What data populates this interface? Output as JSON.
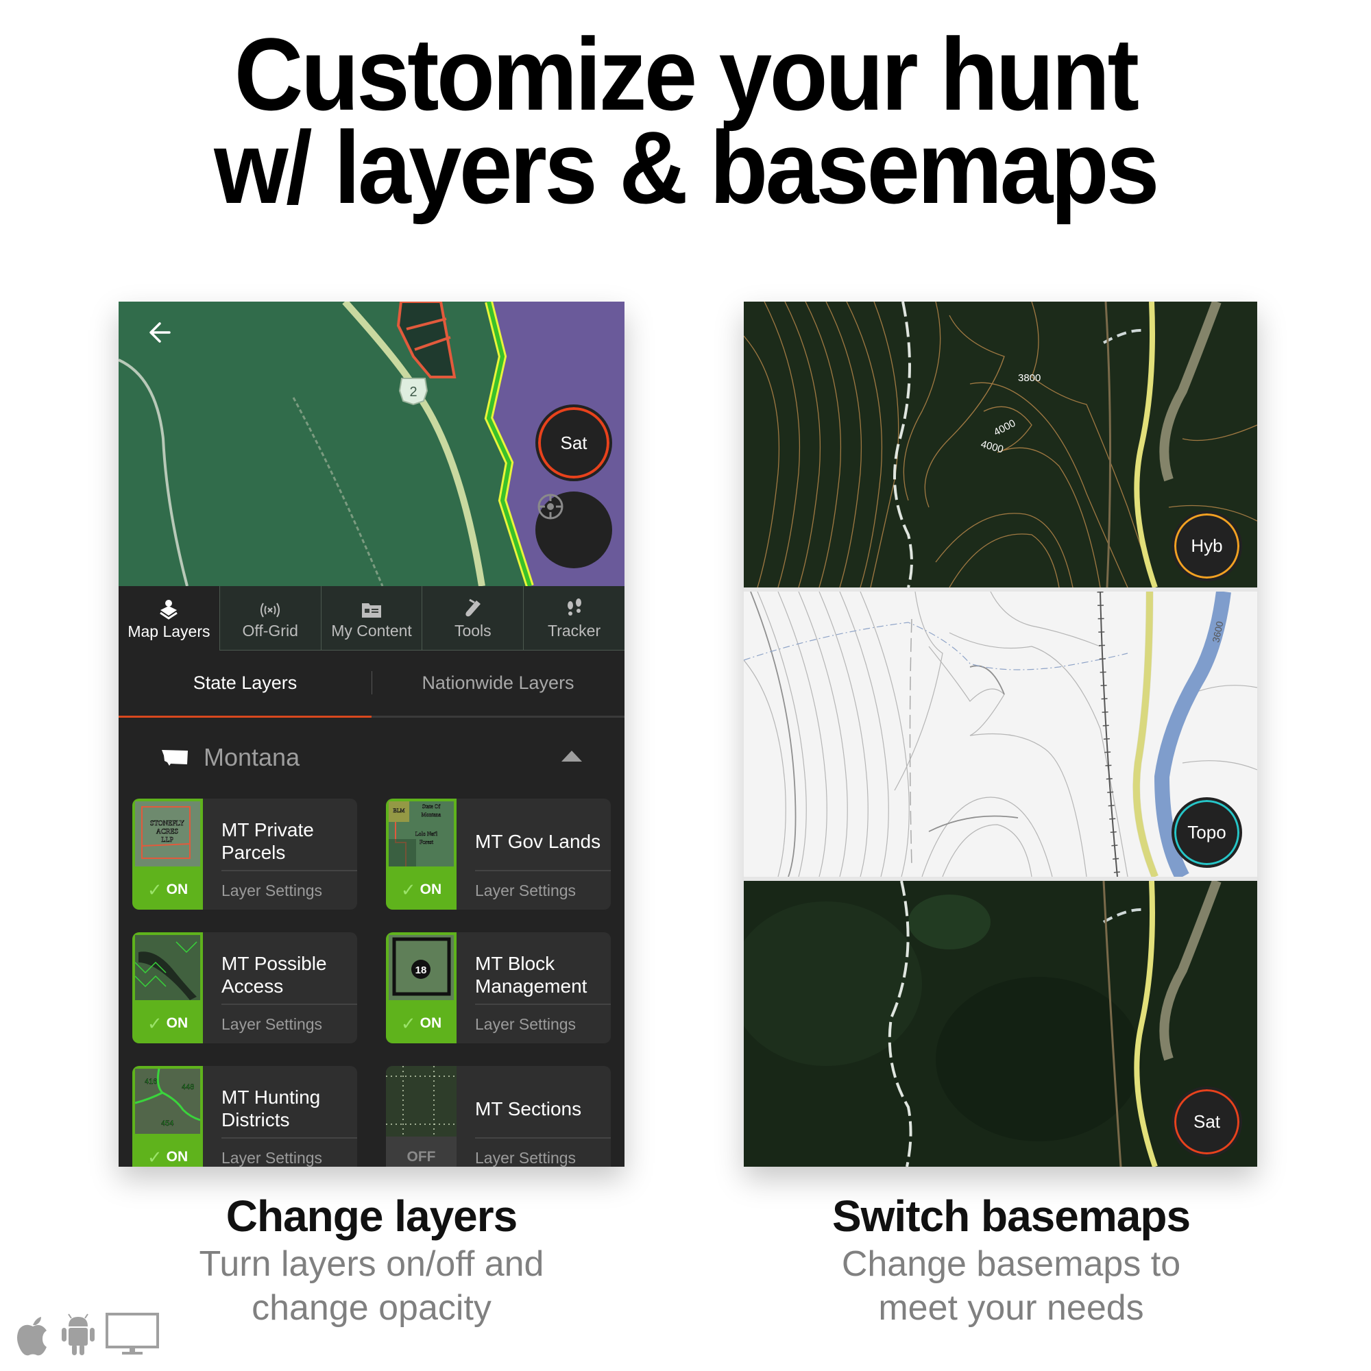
{
  "headline": {
    "line1": "Customize your hunt",
    "line2": "w/ layers & basemaps"
  },
  "left_panel": {
    "map": {
      "back_icon": "arrow-left-icon",
      "route_shield": "2",
      "basemap_button": "Sat",
      "basemap_ring_color": "#e8421c",
      "locate_icon": "locate-crosshair-icon"
    },
    "nav_tabs": [
      {
        "label": "Map Layers",
        "icon": "map-layers-icon",
        "active": true
      },
      {
        "label": "Off-Grid",
        "icon": "off-grid-signal-icon",
        "active": false
      },
      {
        "label": "My Content",
        "icon": "folder-content-icon",
        "active": false
      },
      {
        "label": "Tools",
        "icon": "tools-icon",
        "active": false
      },
      {
        "label": "Tracker",
        "icon": "footprints-tracker-icon",
        "active": false
      }
    ],
    "sub_tabs": [
      {
        "label": "State Layers",
        "active": true
      },
      {
        "label": "Nationwide Layers",
        "active": false
      }
    ],
    "accent_color": "#d8481e",
    "state_section": {
      "name": "Montana",
      "icon": "montana-state-icon",
      "collapse_icon": "caret-up-icon"
    },
    "layers": [
      {
        "title": "MT Private Parcels",
        "status": "ON",
        "settings_label": "Layer Settings",
        "thumb_text": "STONEFLY ACRES LLP"
      },
      {
        "title": "MT Gov Lands",
        "status": "ON",
        "settings_label": "Layer Settings",
        "thumb_text": "BLM / State Of Montana / Lolo Nat'l Forest"
      },
      {
        "title": "MT Possible Access",
        "status": "ON",
        "settings_label": "Layer Settings",
        "thumb_text": ""
      },
      {
        "title": "MT Block Management",
        "status": "ON",
        "settings_label": "Layer Settings",
        "thumb_text": "18"
      },
      {
        "title": "MT Hunting Districts",
        "status": "ON",
        "settings_label": "Layer Settings",
        "thumb_text": "416 448 454"
      },
      {
        "title": "MT Sections",
        "status": "OFF",
        "settings_label": "Layer Settings",
        "thumb_text": ""
      }
    ],
    "on_color": "#5fb31c"
  },
  "right_panel": {
    "basemaps": [
      {
        "label": "Hyb",
        "ring_color": "#f2a122",
        "contour_labels": [
          "3800",
          "4000",
          "4000"
        ]
      },
      {
        "label": "Topo",
        "ring_color": "#26c6c8",
        "contour_labels": [
          "3600"
        ]
      },
      {
        "label": "Sat",
        "ring_color": "#e8421c",
        "contour_labels": []
      }
    ]
  },
  "captions": {
    "left": {
      "title": "Change layers",
      "line1": "Turn layers on/off and",
      "line2": "change opacity"
    },
    "right": {
      "title": "Switch basemaps",
      "line1": "Change basemaps to",
      "line2": "meet your needs"
    }
  },
  "platform_icons": [
    "apple-icon",
    "android-icon",
    "desktop-icon"
  ]
}
